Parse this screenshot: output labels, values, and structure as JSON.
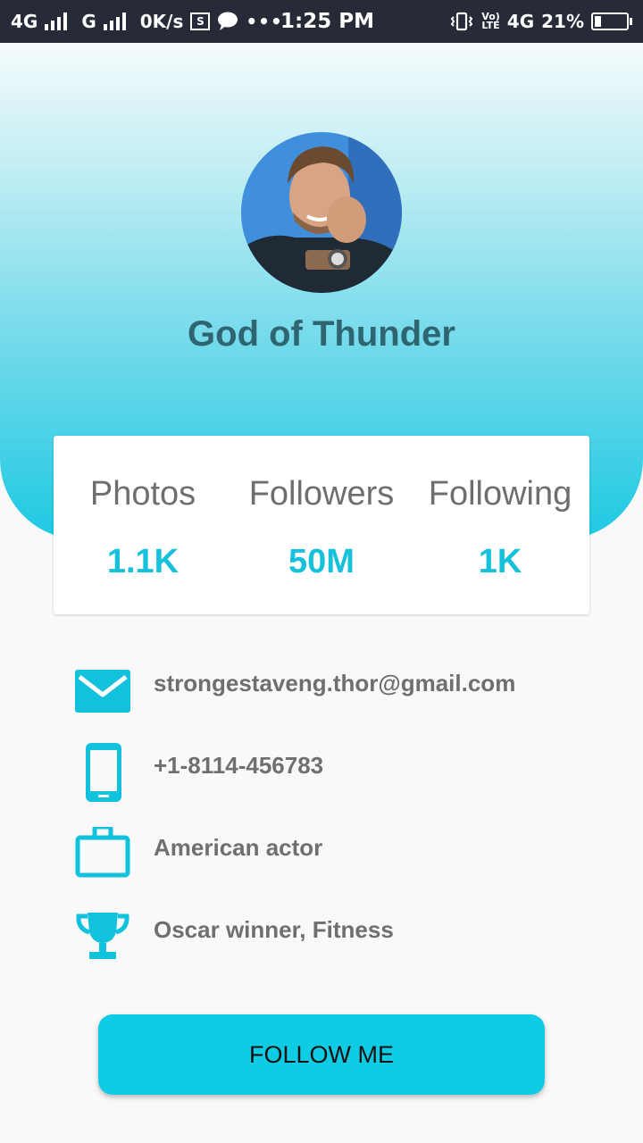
{
  "status_bar": {
    "network1": "4G",
    "network2": "G",
    "speed": "0K/s",
    "more": "•••",
    "time": "1:25 PM",
    "volte_top": "Vo)",
    "volte_bottom": "LTE",
    "network3": "4G",
    "battery": "21%"
  },
  "profile": {
    "name": "God of Thunder"
  },
  "stats": [
    {
      "label": "Photos",
      "value": "1.1K"
    },
    {
      "label": "Followers",
      "value": "50M"
    },
    {
      "label": "Following",
      "value": "1K"
    }
  ],
  "info": [
    {
      "icon": "email-icon",
      "text": "strongestaveng.thor@gmail.com"
    },
    {
      "icon": "phone-icon",
      "text": "+1-8114-456783"
    },
    {
      "icon": "briefcase-icon",
      "text": "American actor"
    },
    {
      "icon": "trophy-icon",
      "text": "Oscar winner, Fitness"
    }
  ],
  "follow_button": {
    "label": "FOLLOW ME"
  },
  "colors": {
    "accent": "#0fcbe3",
    "stat_value": "#16c1dc",
    "name": "#2f6570",
    "status_bar": "#272b38"
  }
}
